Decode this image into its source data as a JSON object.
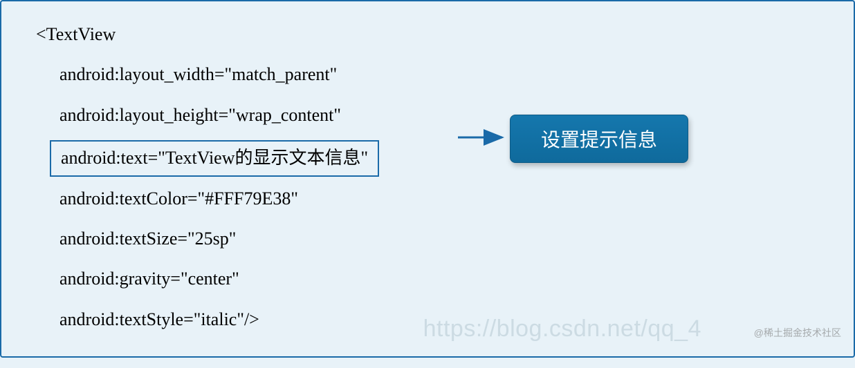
{
  "code": {
    "line1": "<TextView",
    "line2": "android:layout_width=\"match_parent\"",
    "line3": "android:layout_height=\"wrap_content\"",
    "line4": "android:text=\"TextView的显示文本信息\"",
    "line5": "android:textColor=\"#FFF79E38\"",
    "line6": "android:textSize=\"25sp\"",
    "line7": "android:gravity=\"center\"",
    "line8": "android:textStyle=\"italic\"/>"
  },
  "callout": {
    "label": "设置提示信息"
  },
  "watermark": {
    "csdn": "https://blog.csdn.net/qq_4",
    "juejin": "@稀土掘金技术社区"
  },
  "colors": {
    "background": "#e8f2f8",
    "border": "#1a6aa8",
    "callout_bg": "#1577ad",
    "callout_text": "#ffffff",
    "arrow": "#1a6aa8"
  }
}
